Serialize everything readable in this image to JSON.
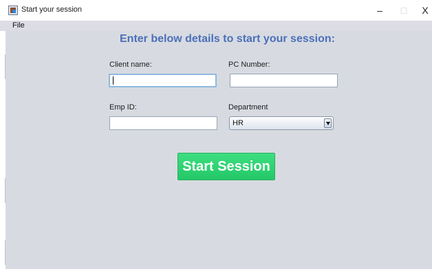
{
  "window": {
    "title": "Start your session",
    "minimize_glyph": "–",
    "maximize_glyph": "□",
    "close_glyph": "X"
  },
  "menu": {
    "file": "File"
  },
  "form": {
    "heading": "Enter below details to start your session:",
    "client_name_label": "Client name:",
    "client_name_value": "",
    "pc_number_label": "PC Number:",
    "pc_number_value": "",
    "emp_id_label": "Emp ID:",
    "emp_id_value": "",
    "department_label": "Department",
    "department_selected": "HR"
  },
  "start_button": {
    "label": "Start Session"
  },
  "colors": {
    "panel_background": "#d7dbe1",
    "heading_blue": "#4c6fb9",
    "button_green": "#2fd572"
  }
}
